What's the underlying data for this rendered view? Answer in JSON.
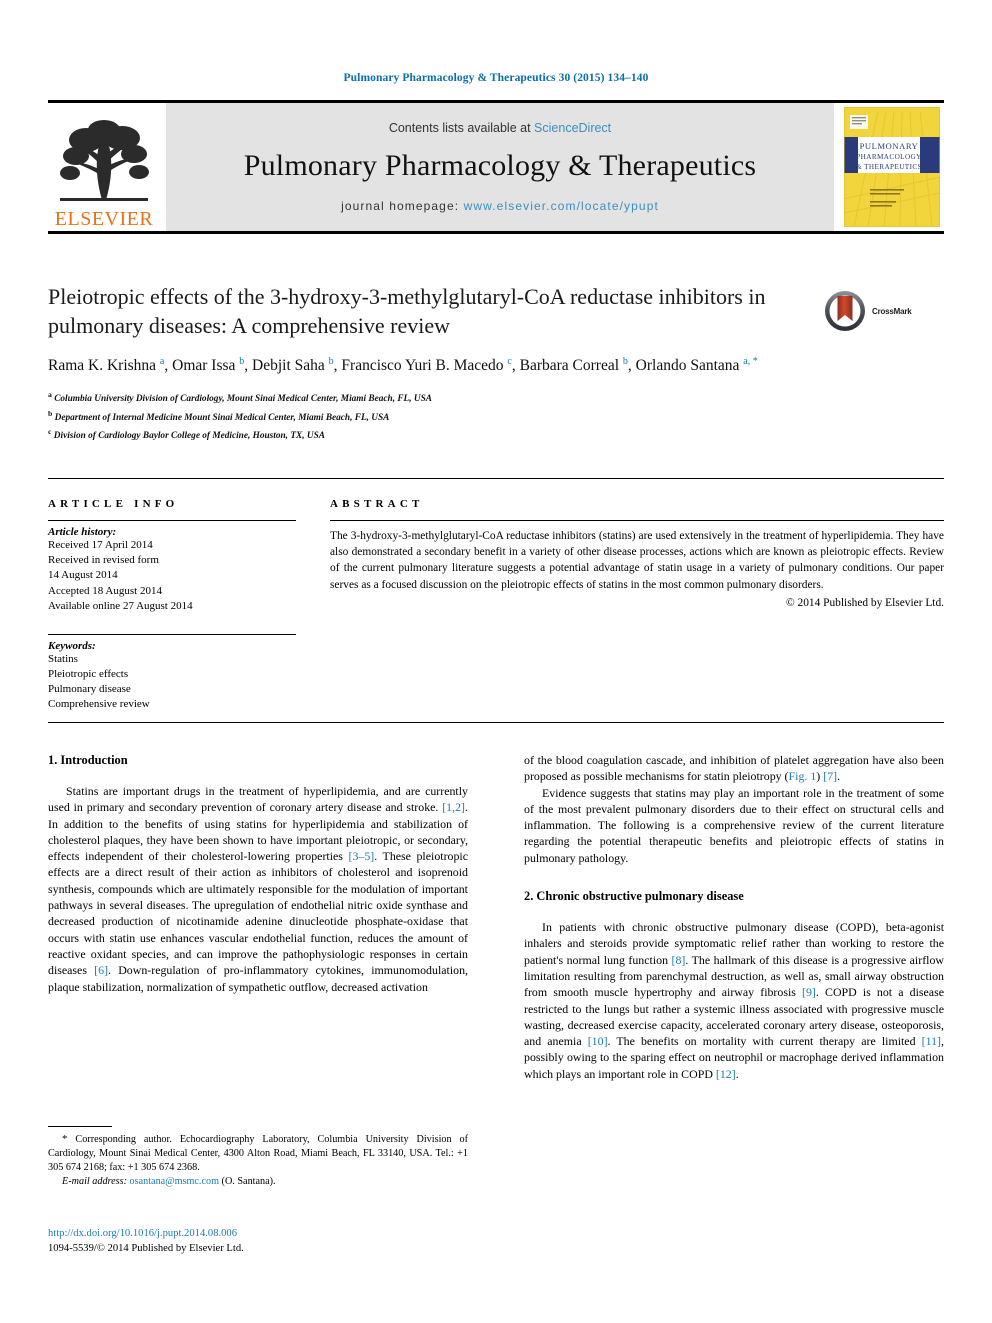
{
  "running_head": "Pulmonary Pharmacology & Therapeutics 30 (2015) 134–140",
  "masthead": {
    "publisher_wordmark": "ELSEVIER",
    "contents_prefix": "Contents lists available at",
    "contents_link": "ScienceDirect",
    "journal_title": "Pulmonary Pharmacology & Therapeutics",
    "homepage_prefix": "journal homepage:",
    "homepage_url": "www.elsevier.com/locate/ypupt",
    "cover_title_line1": "PULMONARY",
    "cover_title_line2": "PHARMACOLOGY",
    "cover_title_line3": "& THERAPEUTICS"
  },
  "crossmark": {
    "label": "CrossMark"
  },
  "title": "Pleiotropic effects of the 3-hydroxy-3-methylglutaryl-CoA reductase inhibitors in pulmonary diseases: A comprehensive review",
  "authors_html": "Rama K. Krishna <sup>a</sup>, Omar Issa <sup>b</sup>, Debjit Saha <sup>b</sup>, Francisco Yuri B. Macedo <sup>c</sup>, Barbara Correal <sup>b</sup>, Orlando Santana <sup>a, *</sup>",
  "affiliations": [
    "Columbia University Division of Cardiology, Mount Sinai Medical Center, Miami Beach, FL, USA",
    "Department of Internal Medicine Mount Sinai Medical Center, Miami Beach, FL, USA",
    "Division of Cardiology Baylor College of Medicine, Houston, TX, USA"
  ],
  "affiliation_markers": [
    "a",
    "b",
    "c"
  ],
  "article_info": {
    "heading": "ARTICLE INFO",
    "history_label": "Article history:",
    "history_lines": [
      "Received 17 April 2014",
      "Received in revised form",
      "14 August 2014",
      "Accepted 18 August 2014",
      "Available online 27 August 2014"
    ],
    "keywords_label": "Keywords:",
    "keywords": [
      "Statins",
      "Pleiotropic effects",
      "Pulmonary disease",
      "Comprehensive review"
    ]
  },
  "abstract": {
    "heading": "ABSTRACT",
    "text": "The 3-hydroxy-3-methylglutaryl-CoA reductase inhibitors (statins) are used extensively in the treatment of hyperlipidemia. They have also demonstrated a secondary benefit in a variety of other disease processes, actions which are known as pleiotropic effects. Review of the current pulmonary literature suggests a potential advantage of statin usage in a variety of pulmonary conditions. Our paper serves as a focused discussion on the pleiotropic effects of statins in the most common pulmonary disorders.",
    "copyright": "© 2014 Published by Elsevier Ltd."
  },
  "body": {
    "left": {
      "section_number_title": "1. Introduction",
      "paragraph_1_html": "Statins are important drugs in the treatment of hyperlipidemia, and are currently used in primary and secondary prevention of coronary artery disease and stroke. <span class=\"ref\">[1,2]</span>. In addition to the benefits of using statins for hyperlipidemia and stabilization of cholesterol plaques, they have been shown to have important pleiotropic, or secondary, effects independent of their cholesterol-lowering properties <span class=\"ref\">[3–5]</span>. These pleiotropic effects are a direct result of their action as inhibitors of cholesterol and isoprenoid synthesis, compounds which are ultimately responsible for the modulation of important pathways in several diseases. The upregulation of endothelial nitric oxide synthase and decreased production of nicotinamide adenine dinucleotide phosphate-oxidase that occurs with statin use enhances vascular endothelial function, reduces the amount of reactive oxidant species, and can improve the pathophysiologic responses in certain diseases <span class=\"ref\">[6]</span>. Down-regulation of pro-inflammatory cytokines, immunomodulation, plaque stabilization, normalization of sympathetic outflow, decreased activation"
    },
    "right": {
      "paragraph_continued_html": "of the blood coagulation cascade, and inhibition of platelet aggregation have also been proposed as possible mechanisms for statin pleiotropy (<span class=\"ref\">Fig. 1</span>) <span class=\"ref\">[7]</span>.",
      "paragraph_2_html": "Evidence suggests that statins may play an important role in the treatment of some of the most prevalent pulmonary disorders due to their effect on structural cells and inflammation. The following is a comprehensive review of the current literature regarding the potential therapeutic benefits and pleiotropic effects of statins in pulmonary pathology.",
      "section_number_title": "2. Chronic obstructive pulmonary disease",
      "paragraph_3_html": "In patients with chronic obstructive pulmonary disease (COPD), beta-agonist inhalers and steroids provide symptomatic relief rather than working to restore the patient's normal lung function <span class=\"ref\">[8]</span>. The hallmark of this disease is a progressive airflow limitation resulting from parenchymal destruction, as well as, small airway obstruction from smooth muscle hypertrophy and airway fibrosis <span class=\"ref\">[9]</span>. COPD is not a disease restricted to the lungs but rather a systemic illness associated with progressive muscle wasting, decreased exercise capacity, accelerated coronary artery disease, osteoporosis, and anemia <span class=\"ref\">[10]</span>. The benefits on mortality with current therapy are limited <span class=\"ref\">[11]</span>, possibly owing to the sparing effect on neutrophil or macrophage derived inflammation which plays an important role in COPD <span class=\"ref\">[12]</span>."
    }
  },
  "footnote": {
    "corresponding_html": "<span style=\"font-size:11px\">*</span> Corresponding author. Echocardiography Laboratory, Columbia University Division of Cardiology, Mount Sinai Medical Center, 4300 Alton Road, Miami Beach, FL 33140, USA. Tel.: +1 305 674 2168; fax: +1 305 674 2368.",
    "email_html": "<span class=\"email-italic\">E-mail address:</span> <span class=\"link\">osantana@msmc.com</span> (O. Santana)."
  },
  "doi": {
    "url": "http://dx.doi.org/10.1016/j.pupt.2014.08.006",
    "issn_line": "1094-5539/© 2014 Published by Elsevier Ltd."
  },
  "colors": {
    "link": "#1d7ca8",
    "running_head": "#0b6ea8",
    "elsevier_orange": "#e8711a",
    "band_gray": "#e3e3e3",
    "cover_yellow": "#f2d43c",
    "cover_navy": "#2b3a7a",
    "crossmark_red": "#c0392b"
  }
}
